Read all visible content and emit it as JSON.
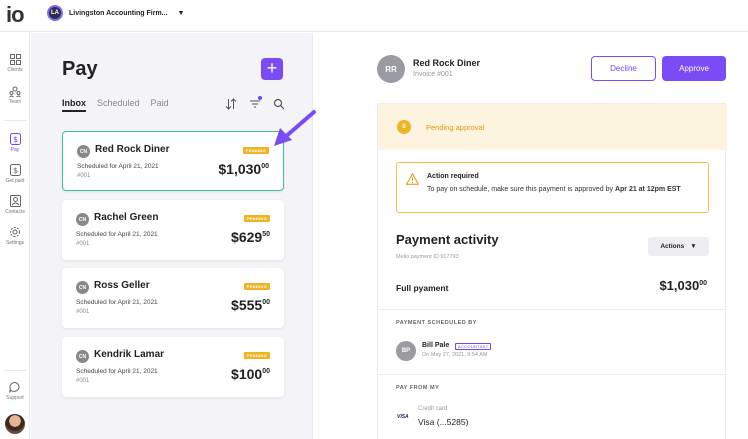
{
  "app": {
    "logo": "io"
  },
  "org": {
    "initials": "LA",
    "name": "Livingston Accounting Firm..."
  },
  "nav": [
    {
      "label": "Clients",
      "icon": "grid-icon"
    },
    {
      "label": "Team",
      "icon": "team-icon"
    },
    {
      "label": "Pay",
      "icon": "pay-icon",
      "active": true
    },
    {
      "label": "Get paid",
      "icon": "get-paid-icon"
    },
    {
      "label": "Contacts",
      "icon": "contacts-icon"
    },
    {
      "label": "Settings",
      "icon": "gear-icon"
    },
    {
      "label": "Support",
      "icon": "support-icon"
    }
  ],
  "pay": {
    "title": "Pay",
    "add_label": "+",
    "tabs": [
      {
        "label": "Inbox",
        "active": true
      },
      {
        "label": "Scheduled"
      },
      {
        "label": "Paid"
      }
    ],
    "cards": [
      {
        "initials": "CN",
        "name": "Red Rock Diner",
        "badge": "PENDING",
        "scheduled": "Scheduled for April 21, 2021",
        "invoice": "#001",
        "amount_main": "$1,030",
        "amount_cents": "00",
        "selected": true
      },
      {
        "initials": "CN",
        "name": "Rachel Green",
        "badge": "PENDING",
        "scheduled": "Scheduled for April 21, 2021",
        "invoice": "#001",
        "amount_main": "$629",
        "amount_cents": "50"
      },
      {
        "initials": "CN",
        "name": "Ross Geller",
        "badge": "PENDING",
        "scheduled": "Scheduled for April 21, 2021",
        "invoice": "#001",
        "amount_main": "$555",
        "amount_cents": "00"
      },
      {
        "initials": "CN",
        "name": "Kendrik Lamar",
        "badge": "PENDING",
        "scheduled": "Scheduled for April 21, 2021",
        "invoice": "#001",
        "amount_main": "$100",
        "amount_cents": "00"
      }
    ]
  },
  "detail": {
    "vendor_initials": "RR",
    "vendor_name": "Red Rock Diner",
    "invoice": "Invoice #001",
    "decline_label": "Decline",
    "approve_label": "Approve",
    "status_icon_text": "II",
    "status_text": "Pending approval",
    "action_title": "Action required",
    "action_body_pre": "To pay on schedule, make sure this payment is approved by ",
    "action_body_bold": "Apr 21 at 12pm EST",
    "activity_title": "Payment activity",
    "melio_id": "Melio payment ID 917793",
    "actions_label": "Actions",
    "full_label": "Full pyament",
    "full_amount_main": "$1,030",
    "full_amount_cents": "00",
    "scheduled_by_label": "PAYMENT SCHEDULED BY",
    "scheduler_initials": "BP",
    "scheduler_name": "Bill Pale",
    "scheduler_role": "ACCOUNTANT",
    "scheduler_date": "On May 27, 2021, 9:54 AM",
    "pay_from_label": "PAY FROM MY",
    "card_brand": "VISA",
    "card_label": "Credit card",
    "card_value": "Visa (...5285)"
  },
  "colors": {
    "accent": "#7b4cf5",
    "pending": "#f0b323",
    "selected_border": "#3cc39a"
  }
}
